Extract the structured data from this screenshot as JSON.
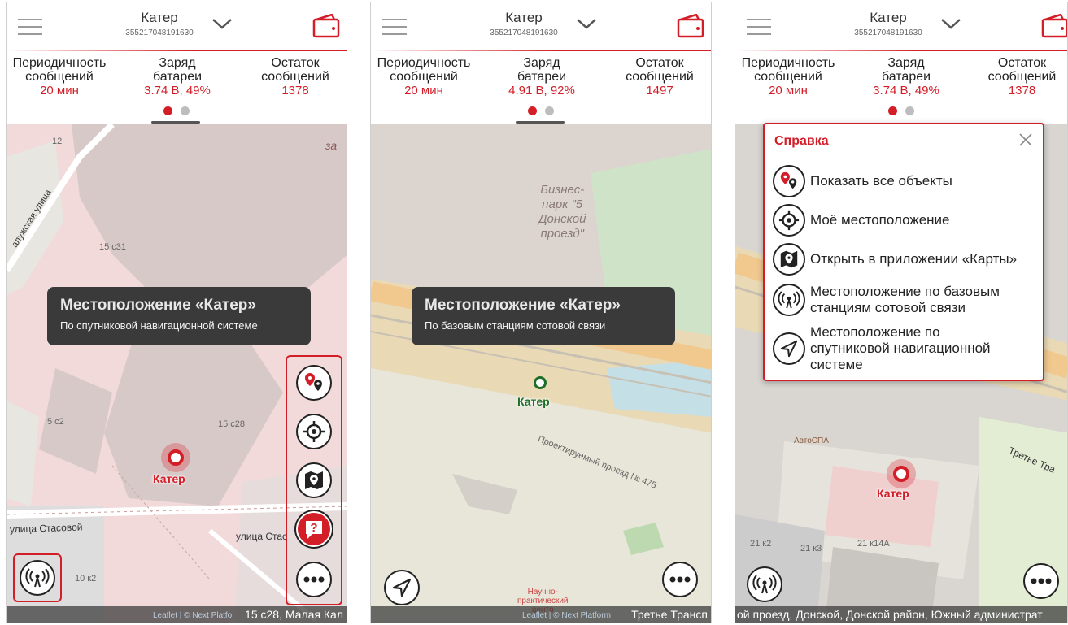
{
  "header": {
    "title": "Катер",
    "imei": "355217048191630"
  },
  "stats_labels": {
    "period_l1": "Периодичность",
    "period_l2": "сообщений",
    "battery_l1": "Заряд",
    "battery_l2": "батареи",
    "remaining_l1": "Остаток",
    "remaining_l2": "сообщений"
  },
  "screens": [
    {
      "period_value": "20 мин",
      "battery_value": "3.74 В, 49%",
      "remaining_value": "1378",
      "toast_title": "Местоположение «Катер»",
      "toast_sub": "По спутниковой навигационной системе",
      "marker_label": "Катер",
      "footer_addr": "15 с28, Малая Кал",
      "footer_attr": "Leaflet | © Next Platfo"
    },
    {
      "period_value": "20 мин",
      "battery_value": "4.91 В, 92%",
      "remaining_value": "1497",
      "toast_title": "Местоположение «Катер»",
      "toast_sub": "По базовым станциям сотовой связи",
      "marker_label": "Катер",
      "footer_addr": "Третье Трансп",
      "footer_attr": "Leaflet | © Next Platform"
    },
    {
      "period_value": "20 мин",
      "battery_value": "3.74 В, 49%",
      "remaining_value": "1378",
      "marker_label": "Катер",
      "footer_addr": "ой проезд, Донской, Донской район, Южный администрат"
    }
  ],
  "map_labels": {
    "s1_street1": "улица Стасовой",
    "s1_street2": "улица Стас",
    "s1_street3": "алужская улица",
    "s1_b1": "15 с31",
    "s1_b2": "15 с28",
    "s1_b3": "5 с2",
    "s1_b4": "12",
    "s1_b5": "10 к2",
    "s1_b6": "за",
    "s2_park": "Бизнес-\nпарк \"5\nДонской\nпроезд\"",
    "s2_street": "Проектируемый проезд № 475",
    "s2_poi": "Научно-\nпрактический\nцентр",
    "s3_poi": "АвтоСПА",
    "s3_street": "Третье Тра",
    "s3_b1": "21 к2",
    "s3_b2": "21 к3",
    "s3_b3": "21 к14А"
  },
  "help": {
    "title": "Справка",
    "items": [
      {
        "text": "Показать все объекты",
        "icon": "pins-icon"
      },
      {
        "text": "Моё местоположение",
        "icon": "crosshair-icon"
      },
      {
        "text": "Открыть в приложении «Карты»",
        "icon": "map-icon"
      },
      {
        "text": "Местоположение по базовым станциям сотовой связи",
        "icon": "cell-tower-icon"
      },
      {
        "text": "Местоположение по спутниковой навигационной системе",
        "icon": "navigation-arrow-icon"
      }
    ]
  },
  "colors": {
    "accent": "#d31e28",
    "map_bg": "#f2efe9",
    "toast_bg": "#3a3a3a",
    "green": "#1f6e28"
  }
}
